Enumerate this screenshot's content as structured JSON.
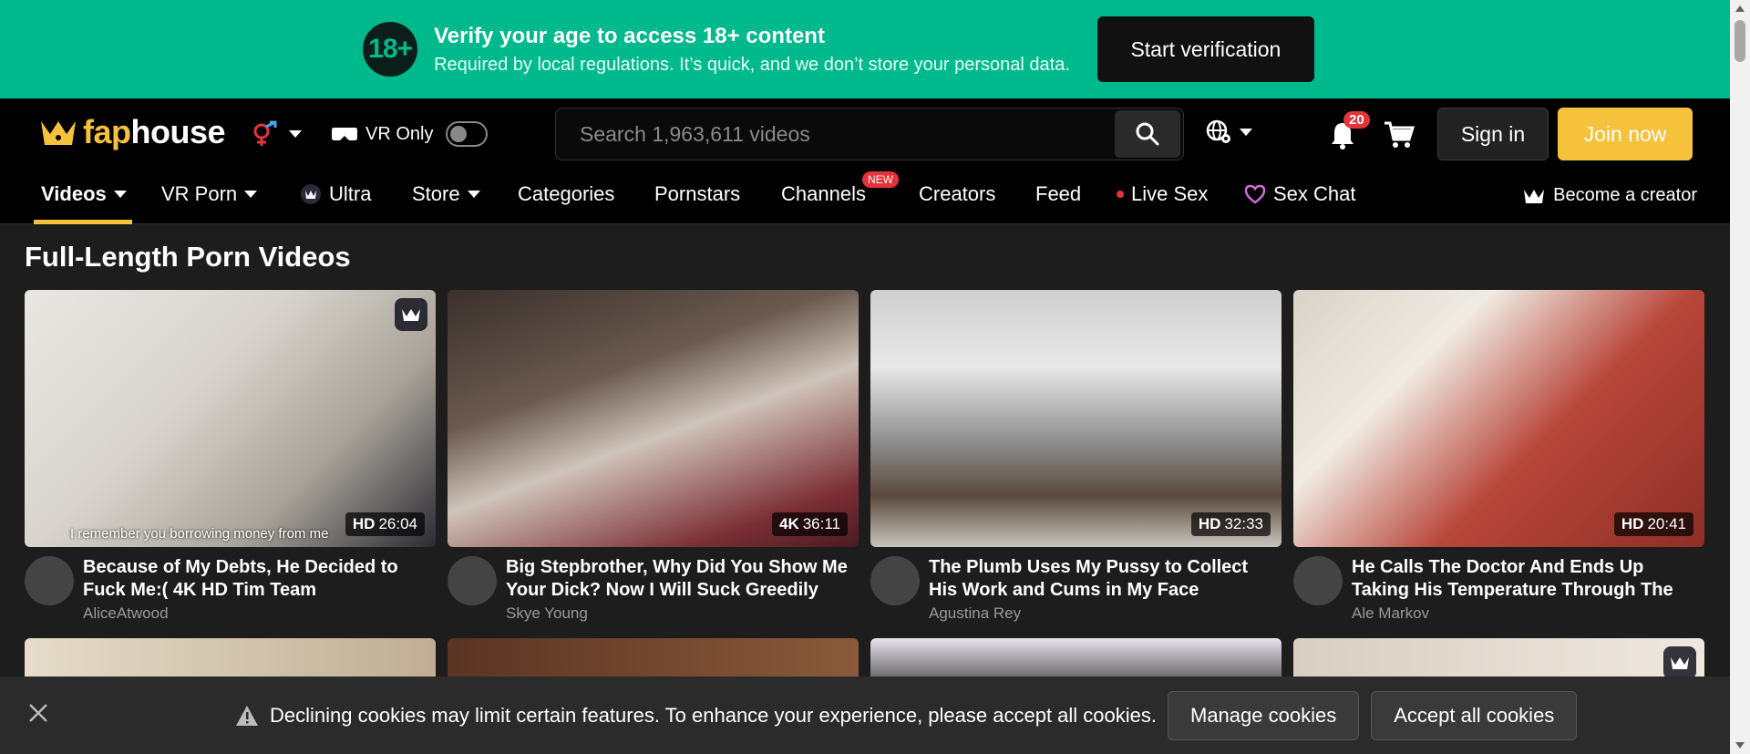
{
  "age_banner": {
    "badge": "18+",
    "title": "Verify your age to access 18+ content",
    "subtitle": "Required by local regulations. It’s quick, and we don’t store your personal data.",
    "button": "Start verification"
  },
  "header": {
    "logo_fap": "fap",
    "logo_house": "house",
    "vr_label": "VR Only",
    "search_placeholder": "Search 1,963,611 videos",
    "notification_count": "20",
    "signin": "Sign in",
    "join": "Join now"
  },
  "nav": {
    "items": [
      "Videos",
      "VR Porn",
      "Ultra",
      "Store",
      "Categories",
      "Pornstars",
      "Channels",
      "Creators",
      "Feed",
      "Live Sex",
      "Sex Chat"
    ],
    "new_badge": "NEW",
    "become_creator": "Become a creator"
  },
  "main": {
    "title": "Full-Length Porn Videos",
    "videos": [
      {
        "title": "Because of My Debts, He Decided to Fuck Me:( 4K HD Tim Team",
        "channel": "AliceAtwood",
        "quality": "HD",
        "duration": "26:04",
        "caption": "I remember you borrowing money from me"
      },
      {
        "title": "Big Stepbrother, Why Did You Show Me Your Dick? Now I Will Suck Greedily and…",
        "channel": "Skye Young",
        "quality": "4K",
        "duration": "36:11",
        "caption": ""
      },
      {
        "title": "The Plumb Uses My Pussy to Collect His Work and Cums in My Face",
        "channel": "Agustina Rey",
        "quality": "HD",
        "duration": "32:33",
        "caption": ""
      },
      {
        "title": "He Calls The Doctor And Ends Up Taking His Temperature Through The Ass With…",
        "channel": "Ale Markov",
        "quality": "HD",
        "duration": "20:41",
        "caption": ""
      }
    ]
  },
  "cookie": {
    "message": "Declining cookies may limit certain features. To enhance your experience, please accept all cookies.",
    "manage": "Manage cookies",
    "accept": "Accept all cookies"
  },
  "colors": {
    "banner": "#00b98c",
    "brand_yellow": "#f6c13b",
    "badge_red": "#e5333b"
  }
}
